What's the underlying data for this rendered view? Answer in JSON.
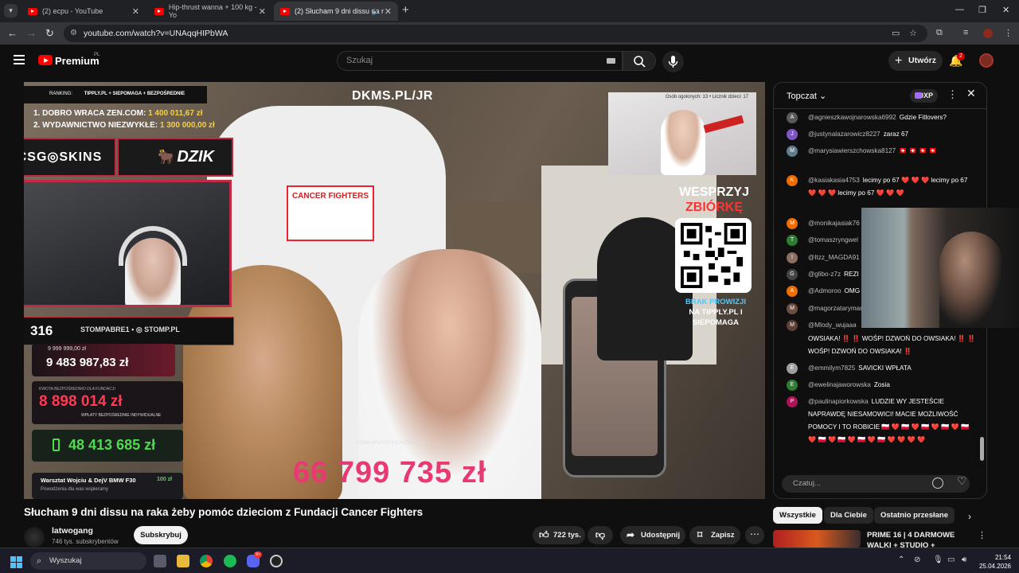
{
  "browser": {
    "tabs": [
      {
        "label": "(2) ecpu - YouTube",
        "active": false
      },
      {
        "label": "Hip-thrust wanna + 100 kg - Yo",
        "active": false
      },
      {
        "label": "(2) Słucham 9 dni dissu na r",
        "active": true
      }
    ],
    "new_tab": "+",
    "url": "youtube.com/watch?v=UNAqqHIPbWA",
    "window_controls": {
      "minimize": "—",
      "restore": "❐",
      "close": "✕"
    }
  },
  "youtube": {
    "brand": "Premium",
    "region": "PL",
    "search_placeholder": "Szukaj",
    "create_label": "Utwórz",
    "notifications_count": "2"
  },
  "video": {
    "title": "Słucham 9 dni dissu na raka żeby pomóc dzieciom z Fundacji Cancer Fighters",
    "channel": "latwogang",
    "subscribers": "746 tys. subskrybentów",
    "subscribe_label": "Subskrybuj",
    "likes": "722 tys.",
    "share_label": "Udostępnij",
    "save_label": "Zapisz"
  },
  "stream_overlay": {
    "url_banner": "DKMS.PL/JR",
    "ranking_label": "RANKING:",
    "ranking_sponsor": "TIPPLY.PL + SIEPOMAGA + BEZPOŚREDNIE",
    "ranking": [
      {
        "pos": "1. DOBRO WRACA ZEN.COM:",
        "value": "1 400 011,67 zł"
      },
      {
        "pos": "2. WYDAWNICTWO NIEZWYKŁE:",
        "value": "1 300 000,00 zł"
      }
    ],
    "sponsor1": "CSG◎SKINS",
    "sponsor2": "DZIK",
    "counter": "316",
    "socials": "STOMPABRE1 • ◎ STOMP.PL",
    "goal_small": "9 999 999,00 zł",
    "goal_value": "9 483 987,83 zł",
    "direct_label": "KWOTA BEZPOŚREDNIO DLA FUNDACJI",
    "direct_value": "8 898 014 zł",
    "direct_sub": "WPŁATY BEZPOŚREDNIE INDYWIDUALNE",
    "green_value": "48 413 685 zł",
    "last_donation_title": "Warsztat Wojciu & DejV BMW F30",
    "last_donation_value": "100 zł",
    "last_donation_sub": "Powodzenia dla was wspieramy",
    "total_label": "SUMA WSZYSTKICH ZBIÓREK",
    "total_value": "66 799 735 zł",
    "support_l1": "WESPRZYJ",
    "support_l2": "ZBIÓRKĘ",
    "brak_l1": "BRAK PROWIZJI",
    "brak_l2": "NA TIPPLY.PL I SIEPOMAGA",
    "mini_text": "Osób ogolonych: 13 • Licznik dzieci: 17",
    "shirt_text": "CANCER FIGHTERS"
  },
  "chat": {
    "mode": "Topczat",
    "xp": "0XP",
    "input_placeholder": "Czatuj...",
    "messages": [
      {
        "initial": "A",
        "color": "#5a5a5a",
        "author": "@agnieszkawojnarowska6992",
        "text": "Gdzie Fitlovers?"
      },
      {
        "initial": "J",
        "color": "#7e57c2",
        "author": "@justynalazarowicz8227",
        "text": "zaraz 67"
      },
      {
        "initial": "M",
        "color": "#607d8b",
        "author": "@marysiawierszchowska8127",
        "text": "🇨🇭 🇨🇭 🇨🇭 🇨🇭"
      },
      {
        "initial": "K",
        "color": "#ef6c00",
        "author": "@kasiakasia4753",
        "text": "lecimy po 67 ❤️ ❤️ ❤️ lecimy po 67 ❤️ ❤️ ❤️ lecimy po 67 ❤️ ❤️ ❤️"
      },
      {
        "initial": "M",
        "color": "#ef6c00",
        "author": "@monikajasiak76",
        "text": ""
      },
      {
        "initial": "T",
        "color": "#2e7d32",
        "author": "@tomaszryngwel",
        "text": ""
      },
      {
        "initial": "I",
        "color": "#8d6e63",
        "author": "@Itzz_MAGDA91",
        "text": ""
      },
      {
        "initial": "G",
        "color": "#444",
        "author": "@glibo-z7z",
        "text": "REZI"
      },
      {
        "initial": "A",
        "color": "#ef6c00",
        "author": "@Admoroo",
        "text": "OMG"
      },
      {
        "initial": "M",
        "color": "#6d4c41",
        "author": "@magorzatarymar",
        "text": ""
      },
      {
        "initial": "M",
        "color": "#5d4037",
        "author": "@Mlody_wujaaa",
        "text": ""
      },
      {
        "initial": "",
        "color": "#000",
        "author": "",
        "text": "OWSIAKA! ‼️ ‼️ WOŚP! DZWOŃ DO OWSIAKA! ‼️ ‼️ WOŚP! DZWOŃ DO OWSIAKA! ‼️"
      },
      {
        "initial": "E",
        "color": "#9e9e9e",
        "author": "@emmilym7825",
        "text": "SAVICKI WPŁATA"
      },
      {
        "initial": "E",
        "color": "#2e7d32",
        "author": "@ewelinajaworowska",
        "text": "Zosia"
      },
      {
        "initial": "P",
        "color": "#ad1457",
        "author": "@paulinapiorkowska",
        "text": "LUDZIE WY JESTEŚCIE NAPRAWDĘ NIESAMOWICI! MACIE MOŻLIWOŚĆ POMOCY I TO ROBICIE 🇵🇱 ❤️ 🇵🇱 ❤️ 🇵🇱 ❤️ 🇵🇱 ❤️ 🇵🇱 ❤️ 🇵🇱 ❤️ 🇵🇱 ❤️ 🇵🇱 ❤️ 🇵🇱 ❤️ ❤️ ❤️ ❤️"
      }
    ]
  },
  "chips": [
    "Wszystkie",
    "Dla Ciebie",
    "Ostatnio przesłane"
  ],
  "recommendation": {
    "title": "PRIME 16 | 4 DARMOWE WALKI + STUDIO + CEREMONIA ..."
  },
  "taskbar": {
    "search_label": "Wyszukaj",
    "time": "21:54",
    "date": "25.04.2026",
    "discord_badge": "9+"
  }
}
